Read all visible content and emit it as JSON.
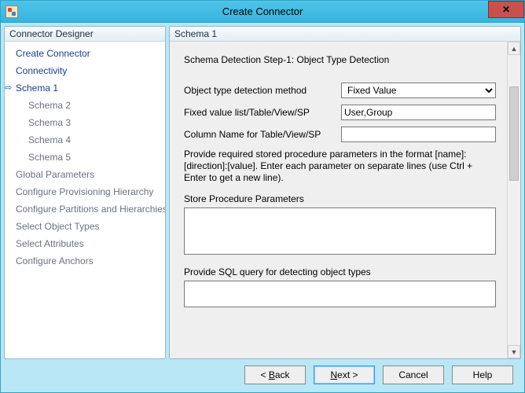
{
  "window": {
    "title": "Create Connector",
    "close_glyph": "✕"
  },
  "sidebar": {
    "header": "Connector Designer",
    "items": [
      {
        "label": "Create Connector",
        "current": false,
        "sub": false,
        "dim": false
      },
      {
        "label": "Connectivity",
        "current": false,
        "sub": false,
        "dim": false
      },
      {
        "label": "Schema 1",
        "current": true,
        "sub": false,
        "dim": false
      },
      {
        "label": "Schema 2",
        "current": false,
        "sub": true,
        "dim": true
      },
      {
        "label": "Schema 3",
        "current": false,
        "sub": true,
        "dim": true
      },
      {
        "label": "Schema 4",
        "current": false,
        "sub": true,
        "dim": true
      },
      {
        "label": "Schema 5",
        "current": false,
        "sub": true,
        "dim": true
      },
      {
        "label": "Global Parameters",
        "current": false,
        "sub": false,
        "dim": true
      },
      {
        "label": "Configure Provisioning Hierarchy",
        "current": false,
        "sub": false,
        "dim": true
      },
      {
        "label": "Configure Partitions and Hierarchies",
        "current": false,
        "sub": false,
        "dim": true
      },
      {
        "label": "Select Object Types",
        "current": false,
        "sub": false,
        "dim": true
      },
      {
        "label": "Select Attributes",
        "current": false,
        "sub": false,
        "dim": true
      },
      {
        "label": "Configure Anchors",
        "current": false,
        "sub": false,
        "dim": true
      }
    ]
  },
  "main": {
    "header": "Schema 1",
    "step_title": "Schema Detection Step-1: Object Type Detection",
    "fields": {
      "method_label": "Object type detection method",
      "method_value": "Fixed Value",
      "fixed_label": "Fixed value list/Table/View/SP",
      "fixed_value": "User,Group",
      "column_label": "Column Name for Table/View/SP",
      "column_value": ""
    },
    "hint": "Provide required stored procedure parameters in the format [name]:[direction]:[value]. Enter each parameter on separate lines (use Ctrl + Enter to get a new line).",
    "sp_label": "Store Procedure Parameters",
    "sp_value": "",
    "sql_label": "Provide SQL query for detecting object types",
    "sql_value": ""
  },
  "buttons": {
    "back_prefix": "<  ",
    "back_u": "B",
    "back_suffix": "ack",
    "next_u": "N",
    "next_suffix": "ext  >",
    "cancel": "Cancel",
    "help": "Help"
  },
  "scroll": {
    "up": "▲",
    "down": "▼"
  }
}
